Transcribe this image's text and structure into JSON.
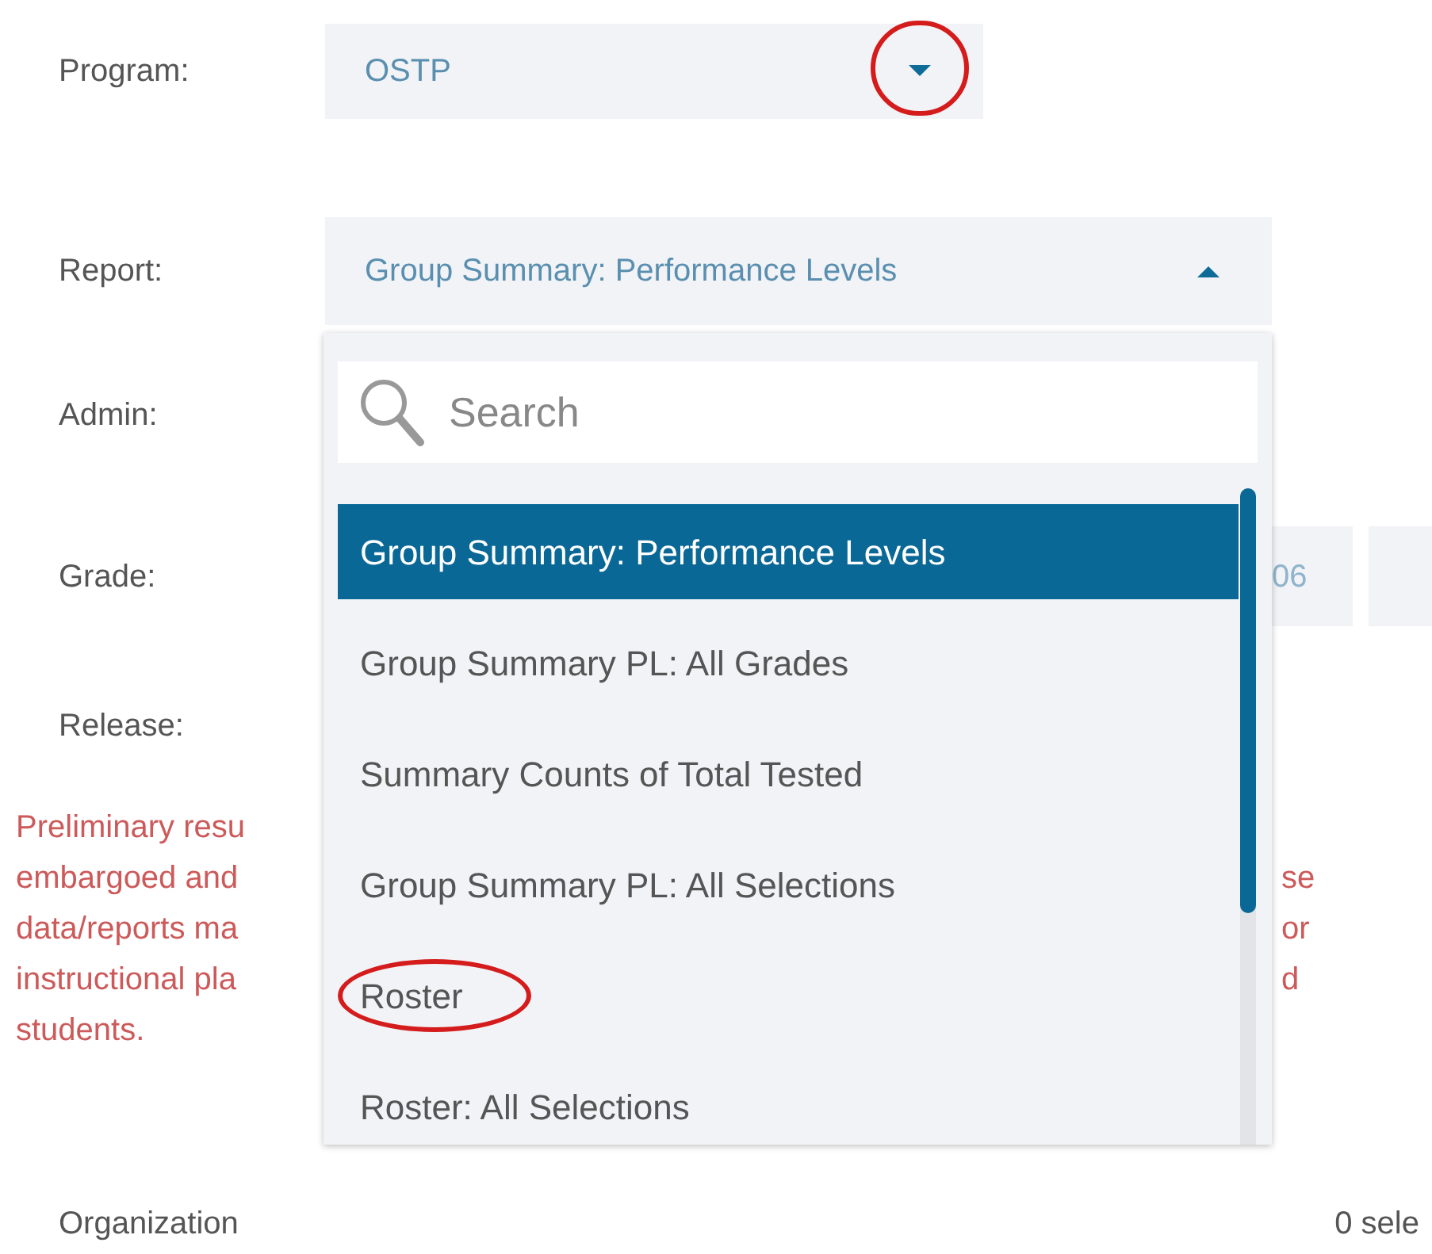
{
  "fields": [
    {
      "kind": "select",
      "label": "Program:",
      "value": "OSTP",
      "expanded": false,
      "circled": true
    },
    {
      "kind": "select",
      "label": "Report:",
      "value": "Group Summary: Performance Levels",
      "expanded": true
    },
    {
      "kind": "covered",
      "label": "Admin:"
    },
    {
      "kind": "chips",
      "label": "Grade:",
      "chips": [
        "06"
      ],
      "overflow": true
    },
    {
      "kind": "covered",
      "label": "Release:"
    }
  ],
  "warning": [
    {
      "left": "Preliminary resu"
    },
    {
      "left": "embargoed and",
      "right": "se"
    },
    {
      "left": "data/reports ma",
      "right": "or"
    },
    {
      "left": "instructional pla",
      "right": "d"
    },
    {
      "left": "students."
    }
  ],
  "dropdown": {
    "search_placeholder": "Search",
    "options": [
      {
        "label": "Group Summary: Performance Levels",
        "selected": true
      },
      {
        "label": "Group Summary PL: All Grades",
        "selected": false
      },
      {
        "label": "Summary Counts of Total Tested",
        "selected": false
      },
      {
        "label": "Group Summary PL: All Selections",
        "selected": false
      },
      {
        "label": "Roster",
        "selected": false,
        "circled": true
      },
      {
        "label": "Roster: All Selections",
        "selected": false
      }
    ]
  },
  "organization": {
    "label": "Organization",
    "count": "0 sele"
  }
}
